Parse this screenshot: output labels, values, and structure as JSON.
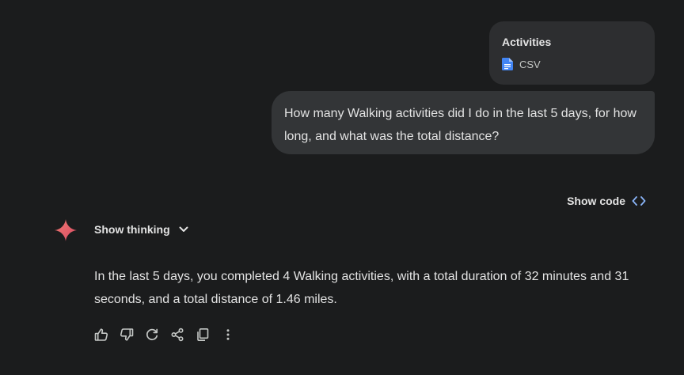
{
  "attachment": {
    "title": "Activities",
    "file_type": "CSV",
    "icon": "google-doc-icon",
    "icon_color": "#4285f4"
  },
  "user_message": {
    "text": "How many Walking activities did I do in the last 5 days, for how long, and what was the total distance?"
  },
  "show_code": {
    "label": "Show code",
    "icon": "code-brackets-icon",
    "icon_color": "#8ab4f8"
  },
  "assistant": {
    "avatar_icon": "sparkle-icon",
    "avatar_color": "#e5616b",
    "show_thinking_label": "Show thinking",
    "response": "In the last 5 days, you completed 4 Walking activities, with a total duration of 32 minutes and 31 seconds, and a total distance of 1.46 miles."
  },
  "actions": [
    {
      "name": "thumbs-up-icon"
    },
    {
      "name": "thumbs-down-icon"
    },
    {
      "name": "regenerate-icon"
    },
    {
      "name": "share-icon"
    },
    {
      "name": "copy-icon"
    },
    {
      "name": "more-options-icon"
    }
  ],
  "colors": {
    "background": "#1b1c1d",
    "bubble": "#333537",
    "card": "#2d2e30",
    "text": "#e3e3e3"
  }
}
